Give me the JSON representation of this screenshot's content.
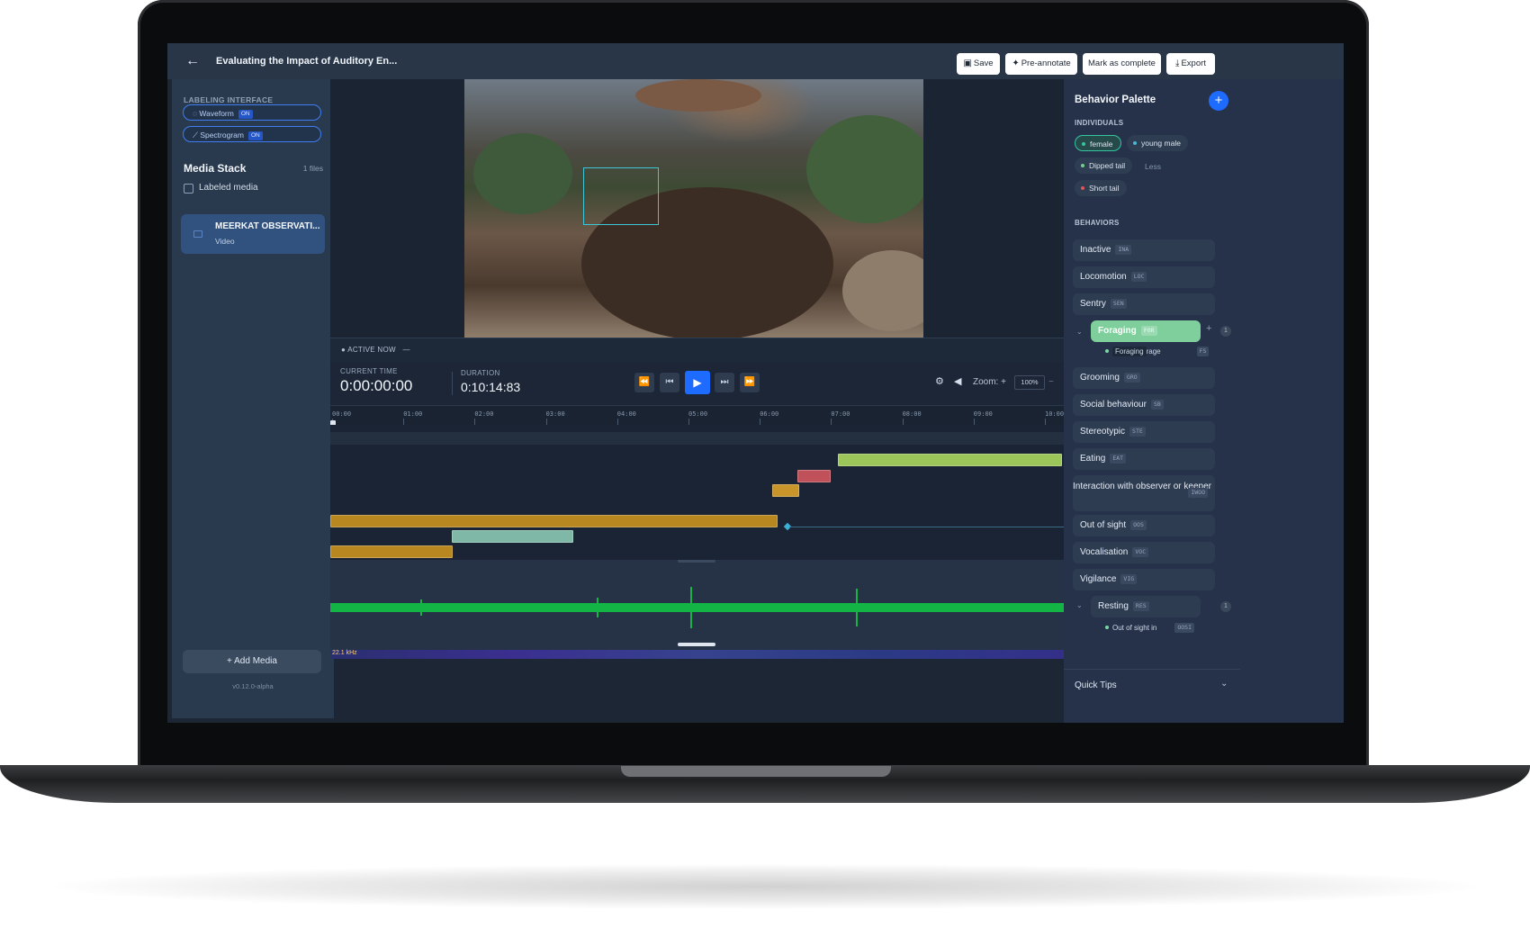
{
  "header": {
    "back_icon": "arrow-left-icon",
    "title": "Evaluating the Impact of Auditory En...",
    "buttons": {
      "save": "Save",
      "pre_annotate": "Pre-annotate",
      "mark_complete": "Mark as complete",
      "export": "Export"
    }
  },
  "sidebar": {
    "labeling_interface_label": "LABELING INTERFACE",
    "waveform": "Waveform",
    "spectrogram": "Spectrogram",
    "on_badge": "ON",
    "media_stack_title": "Media Stack",
    "files_count": "1 files",
    "labeled_media": "Labeled media",
    "media_item": {
      "name": "MEERKAT OBSERVATI...",
      "type": "Video"
    },
    "add_media": "Add Media",
    "version": "v0.12.0-alpha"
  },
  "player": {
    "active_now": "ACTIVE NOW",
    "active_dash": "—",
    "current_time_label": "CURRENT TIME",
    "current_time": "0:00:00:00",
    "duration_label": "DURATION",
    "duration": "0:10:14:83",
    "zoom_label": "Zoom:",
    "zoom_plus": "+",
    "zoom_value": "100%",
    "zoom_minus": "−"
  },
  "timeline": {
    "ticks": [
      "00:00",
      "01:00",
      "02:00",
      "03:00",
      "04:00",
      "05:00",
      "06:00",
      "07:00",
      "08:00",
      "09:00",
      "10:00"
    ],
    "segments": [
      {
        "start": 0.695,
        "end": 1.0,
        "row": 0,
        "color": "#9dc65a"
      },
      {
        "start": 0.64,
        "end": 0.683,
        "row": 1,
        "color": "#c0505a"
      },
      {
        "start": 0.605,
        "end": 0.64,
        "row": 2,
        "color": "#c9952a"
      },
      {
        "start": 0.0,
        "end": 0.61,
        "row": 3,
        "color": "#b8871f"
      },
      {
        "start": 0.167,
        "end": 0.33,
        "row": 4,
        "color": "#7fb8a6"
      },
      {
        "start": 0.0,
        "end": 0.165,
        "row": 5,
        "color": "#b8871f"
      }
    ],
    "spectro_label": "22.1 kHz"
  },
  "palette": {
    "title": "Behavior Palette",
    "individuals_label": "INDIVIDUALS",
    "individuals": [
      {
        "name": "female",
        "color": "#35c6a0"
      },
      {
        "name": "young male",
        "color": "#4ab8d6"
      },
      {
        "name": "Dipped tail",
        "color": "#6fd08a"
      },
      {
        "name": "Short tail",
        "color": "#e25555"
      }
    ],
    "less": "Less",
    "behaviors_label": "BEHAVIORS",
    "behaviors": [
      {
        "name": "Inactive",
        "code": "INA"
      },
      {
        "name": "Locomotion",
        "code": "LOC"
      },
      {
        "name": "Sentry",
        "code": "SEN"
      },
      {
        "name": "Foraging",
        "code": "FOR"
      },
      {
        "name": "Grooming",
        "code": "GRO"
      },
      {
        "name": "Social behaviour",
        "code": "SB"
      },
      {
        "name": "Stereotypic",
        "code": "STE"
      },
      {
        "name": "Eating",
        "code": "EAT"
      },
      {
        "name": "Interaction with observer or keeper",
        "code": "IWOO"
      },
      {
        "name": "Out of sight",
        "code": "OOS"
      },
      {
        "name": "Vocalisation",
        "code": "VOC"
      },
      {
        "name": "Vigilance",
        "code": "VIG"
      },
      {
        "name": "Resting",
        "code": "RES"
      }
    ],
    "foraging_sub": {
      "tooltip": "Foraging",
      "name_tail": "rage",
      "code": "FS"
    },
    "resting_sub": {
      "name": "Out of sight in",
      "code": "OOSI"
    },
    "foraging_count": "1",
    "resting_count": "1",
    "quick_tips": "Quick Tips"
  }
}
